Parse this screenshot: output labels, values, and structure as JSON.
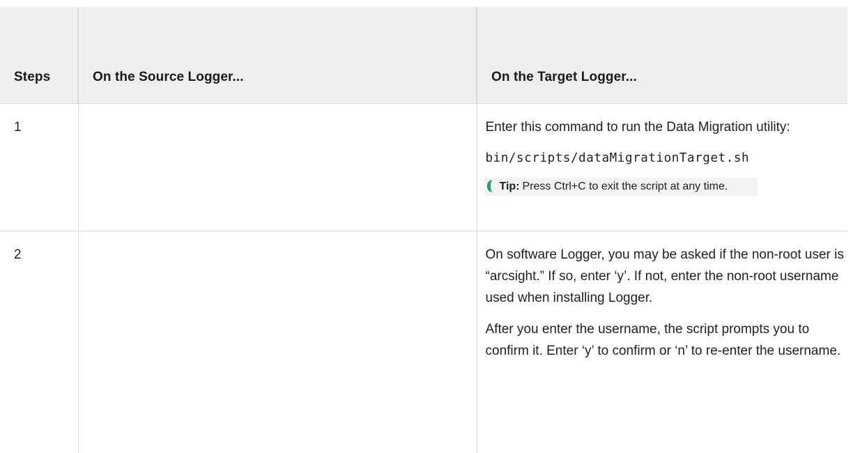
{
  "table": {
    "headers": {
      "steps": "Steps",
      "source": "On the Source Logger...",
      "target": "On the Target Logger..."
    },
    "rows": [
      {
        "step": "1",
        "source": "",
        "target": {
          "para1": "Enter this command to run the Data Migration utility:",
          "code": "bin/scripts/dataMigrationTarget.sh",
          "tip_label": "Tip:",
          "tip_text": "Press Ctrl+C to exit the script at any time."
        }
      },
      {
        "step": "2",
        "source": "",
        "target": {
          "para1": "On software Logger, you may be asked if the non-root user is “arcsight.” If so, enter ‘y’. If not, enter the non-root username used when installing Logger.",
          "para2": "After you enter the username, the script prompts you to confirm it. Enter ‘y’ to confirm or ‘n’ to re-enter the username."
        }
      }
    ]
  },
  "colors": {
    "header_bg": "#eeeeee",
    "tip_bg": "#f2f2f2",
    "tip_accent": "#1aa07a",
    "border": "#dcdcdc"
  }
}
